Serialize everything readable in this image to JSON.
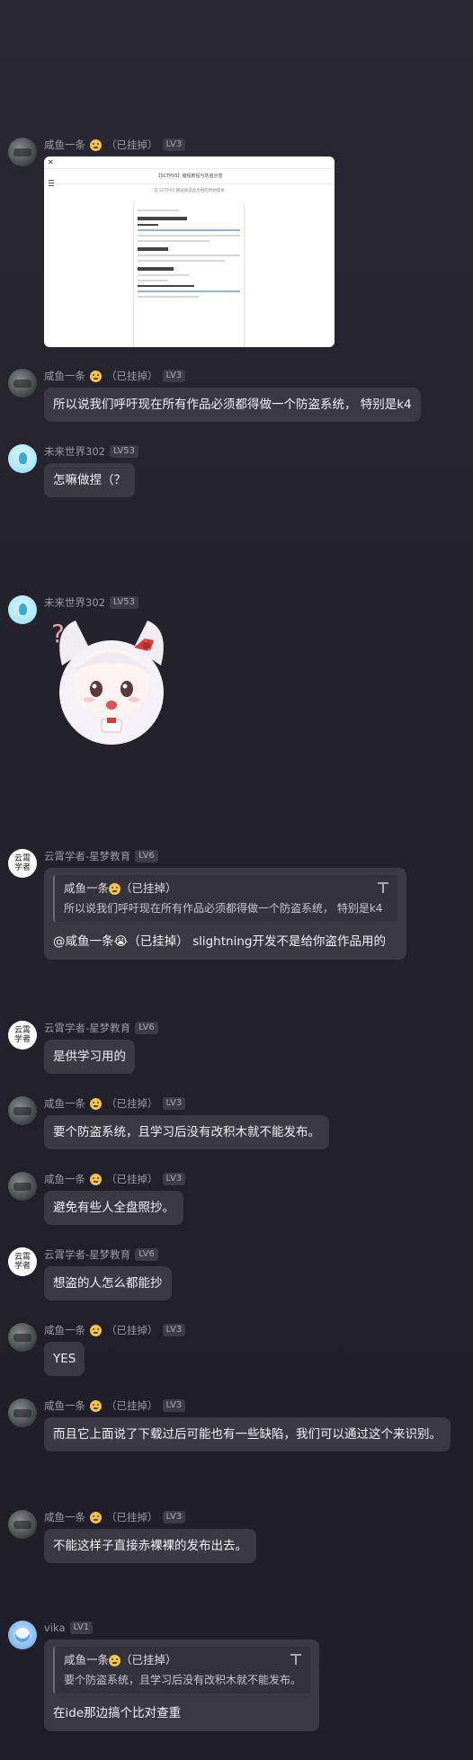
{
  "messages": [
    {
      "name": "咸鱼一条",
      "tag": "（已挂掉）",
      "level": "LV3"
    },
    {
      "name": "咸鱼一条",
      "tag": "（已挂掉）",
      "level": "LV3",
      "text": "所以说我们呼吁现在所有作品必须都得做一个防盗系统， 特别是k4"
    },
    {
      "name": "未来世界302",
      "level": "LV53",
      "text": "怎嘛做捏（？"
    },
    {
      "name": "未来世界302",
      "level": "LV53"
    },
    {
      "name": "云霄学者-星梦教育",
      "level": "LV6",
      "quote_author": "咸鱼一条",
      "quote_tag": "（已挂掉）",
      "quote_text": "所以说我们呼吁现在所有作品必须都得做一个防盗系统， 特别是k4",
      "text": "@咸鱼一条😭（已挂掉） slightning开发不是给你盗作品用的"
    },
    {
      "name": "云霄学者-星梦教育",
      "level": "LV6",
      "text": "是供学习用的"
    },
    {
      "name": "咸鱼一条",
      "tag": "（已挂掉）",
      "level": "LV3",
      "text": "要个防盗系统，且学习后没有改积木就不能发布。"
    },
    {
      "name": "咸鱼一条",
      "tag": "（已挂掉）",
      "level": "LV3",
      "text": "避免有些人全盘照抄。"
    },
    {
      "name": "云霄学者-星梦教育",
      "level": "LV6",
      "text": "想盗的人怎么都能抄"
    },
    {
      "name": "咸鱼一条",
      "tag": "（已挂掉）",
      "level": "LV3",
      "text": "YES"
    },
    {
      "name": "咸鱼一条",
      "tag": "（已挂掉）",
      "level": "LV3",
      "text": "而且它上面说了下载过后可能也有一些缺陷，我们可以通过这个来识别。"
    },
    {
      "name": "咸鱼一条",
      "tag": "（已挂掉）",
      "level": "LV3",
      "text": "不能这样子直接赤裸裸的发布出去。"
    },
    {
      "name": "vika",
      "level": "LV1",
      "quote_author": "咸鱼一条",
      "quote_tag": "（已挂掉）",
      "quote_text": "要个防盗系统，且学习后没有改积木就不能发布。",
      "text": "在ide那边搞个比对查重"
    }
  ],
  "screenshot": {
    "title": "【SCTP95】编程教程与防盗示意",
    "subtitle": "在 SCTP95 网站阅读此文档的原始版本",
    "doc_heading": "游戏文档编号4"
  },
  "avatar_text": {
    "yunyu": "云霄\n学者"
  },
  "colors": {
    "background": "#26242e",
    "bubble": "#3b3a43",
    "level_badge": "#3d3c46"
  }
}
